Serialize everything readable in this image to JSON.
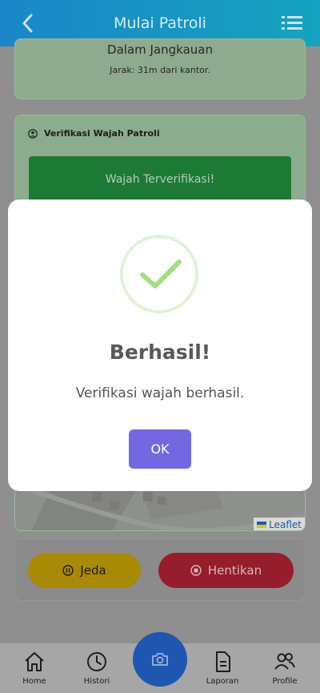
{
  "header": {
    "title": "Mulai Patroli",
    "back_icon": "chevron-left-icon",
    "menu_icon": "list-icon"
  },
  "range_card": {
    "status": "Dalam Jangkauan",
    "distance": "Jarak: 31m dari kantor."
  },
  "face_card": {
    "heading": "Verifikasi Wajah Patroli",
    "status": "Wajah Terverifikasi!"
  },
  "map": {
    "attribution": "Leaflet"
  },
  "actions": {
    "pause_label": "Jeda",
    "stop_label": "Hentikan"
  },
  "nav": {
    "items": [
      {
        "label": "Home",
        "icon": "home-icon"
      },
      {
        "label": "Histori",
        "icon": "clock-icon"
      },
      {
        "label": "Laporan",
        "icon": "document-icon"
      },
      {
        "label": "Profile",
        "icon": "users-icon"
      }
    ],
    "camera_icon": "camera-icon"
  },
  "modal": {
    "title": "Berhasil!",
    "message": "Verifikasi wajah berhasil.",
    "ok_label": "OK",
    "success_color": "#a5dc86",
    "button_color": "#7367f0"
  },
  "colors": {
    "header_start": "#1a86c9",
    "header_end": "#15a3bf"
  }
}
